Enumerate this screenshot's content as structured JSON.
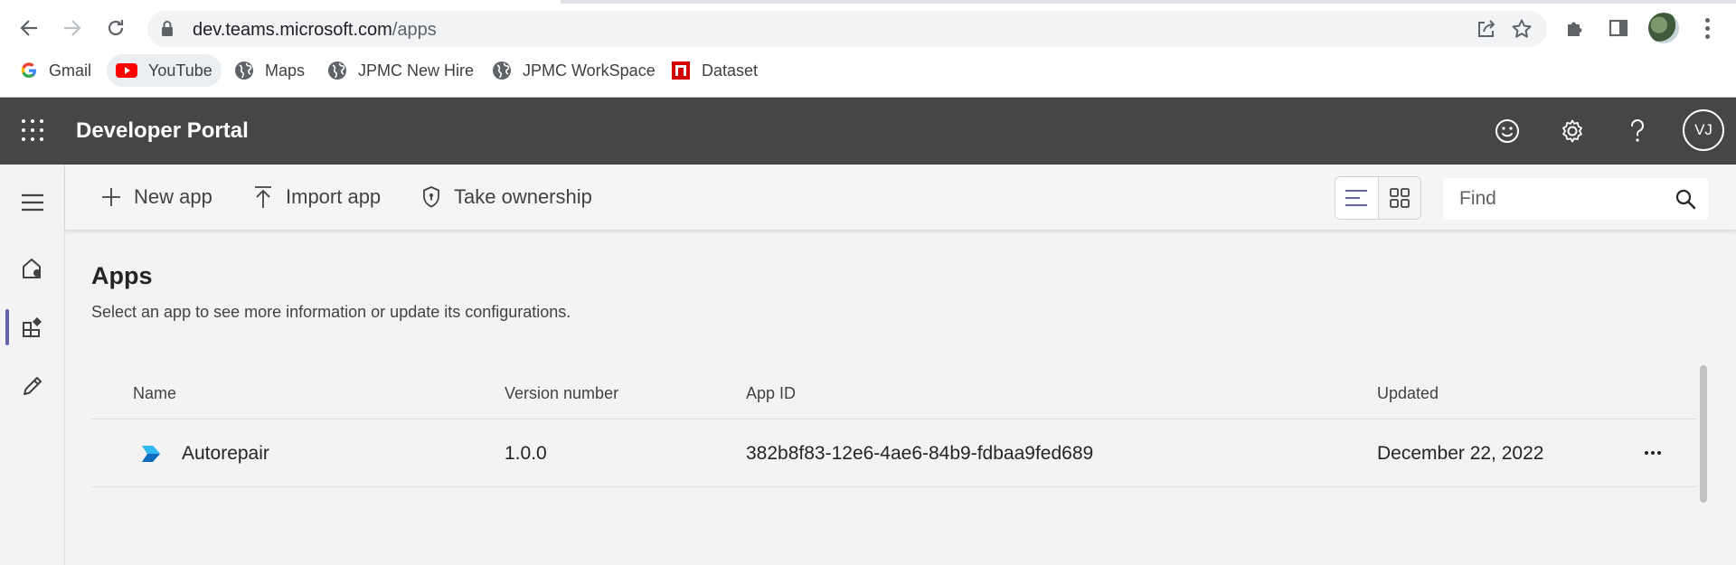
{
  "browser": {
    "url_host": "dev.teams.microsoft.com",
    "url_path": "/apps",
    "bookmarks": [
      {
        "label": "Gmail",
        "icon": "google-icon"
      },
      {
        "label": "YouTube",
        "icon": "youtube-icon"
      },
      {
        "label": "Maps",
        "icon": "globe-icon"
      },
      {
        "label": "JPMC New Hire",
        "icon": "globe-icon"
      },
      {
        "label": "JPMC WorkSpace",
        "icon": "globe-icon"
      },
      {
        "label": "Dataset",
        "icon": "dataset-icon"
      }
    ]
  },
  "header": {
    "title": "Developer Portal",
    "user_initials": "VJ"
  },
  "toolbar": {
    "new_app_label": "New app",
    "import_app_label": "Import app",
    "take_ownership_label": "Take ownership",
    "find_placeholder": "Find"
  },
  "main": {
    "title": "Apps",
    "subtitle": "Select an app to see more information or update its configurations.",
    "table": {
      "columns": [
        "Name",
        "Version number",
        "App ID",
        "Updated"
      ],
      "rows": [
        {
          "name": "Autorepair",
          "version": "1.0.0",
          "app_id": "382b8f83-12e6-4ae6-84b9-fdbaa9fed689",
          "updated": "December 22, 2022"
        }
      ]
    }
  },
  "colors": {
    "header_bg": "#464646",
    "accent": "#6264a7",
    "app_logo": "#0f6cbd"
  }
}
